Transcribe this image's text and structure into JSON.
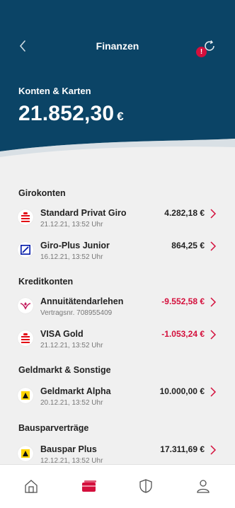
{
  "header": {
    "title": "Finanzen",
    "alert_badge": "!",
    "section_label": "Konten & Karten",
    "total_amount": "21.852,30",
    "total_currency": "€"
  },
  "colors": {
    "header_bg": "#0b4466",
    "accent_red": "#d40f3c",
    "negative": "#d40f3c"
  },
  "groups": [
    {
      "title": "Girokonten",
      "rows": [
        {
          "icon": "sparkasse-logo-icon",
          "name": "Standard Privat Giro",
          "sub": "21.12.21, 13:52 Uhr",
          "amount": "4.282,18 €",
          "negative": false
        },
        {
          "icon": "deutsche-bank-logo-icon",
          "name": "Giro-Plus Junior",
          "sub": "16.12.21, 13:52 Uhr",
          "amount": "864,25 €",
          "negative": false
        }
      ]
    },
    {
      "title": "Kreditkonten",
      "rows": [
        {
          "icon": "bank-logo-icon",
          "name": "Annuitätendarlehen",
          "sub": "Vertragsnr. 708955409",
          "amount": "-9.552,58 €",
          "negative": true
        },
        {
          "icon": "sparkasse-logo-icon",
          "name": "VISA Gold",
          "sub": "21.12.21, 13:52 Uhr",
          "amount": "-1.053,24 €",
          "negative": true
        }
      ]
    },
    {
      "title": "Geldmarkt & Sonstige",
      "rows": [
        {
          "icon": "geldmarkt-logo-icon",
          "name": "Geldmarkt Alpha",
          "sub": "20.12.21, 13:52 Uhr",
          "amount": "10.000,00 €",
          "negative": false
        }
      ]
    },
    {
      "title": "Bausparverträge",
      "rows": [
        {
          "icon": "bauspar-logo-icon",
          "name": "Bauspar Plus",
          "sub": "12.12.21, 13:52 Uhr",
          "amount": "17.311,69 €",
          "negative": false
        }
      ]
    }
  ],
  "tabbar": {
    "active": "finanzen"
  }
}
